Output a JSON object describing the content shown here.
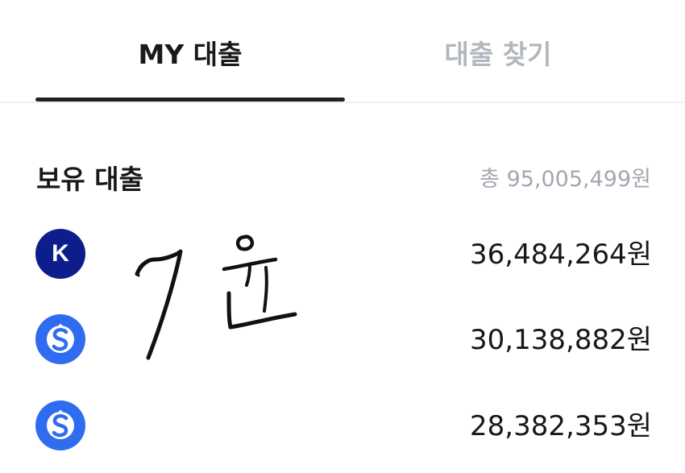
{
  "tabs": {
    "my_loans": "MY 대출",
    "find_loans": "대출 찾기"
  },
  "holdings": {
    "title": "보유 대출",
    "total": "총 95,005,499원"
  },
  "loans": [
    {
      "logo_letter": "K",
      "logo_color": "#0d1e8c",
      "amount": "36,484,264원",
      "icon": "k-bank-logo-icon"
    },
    {
      "logo_color": "#2f6cf0",
      "amount": "30,138,882원",
      "icon": "s-bank-logo-icon"
    },
    {
      "logo_color": "#2f6cf0",
      "amount": "28,382,353원",
      "icon": "s-bank-logo-icon"
    }
  ],
  "handwritten_note": "7원"
}
